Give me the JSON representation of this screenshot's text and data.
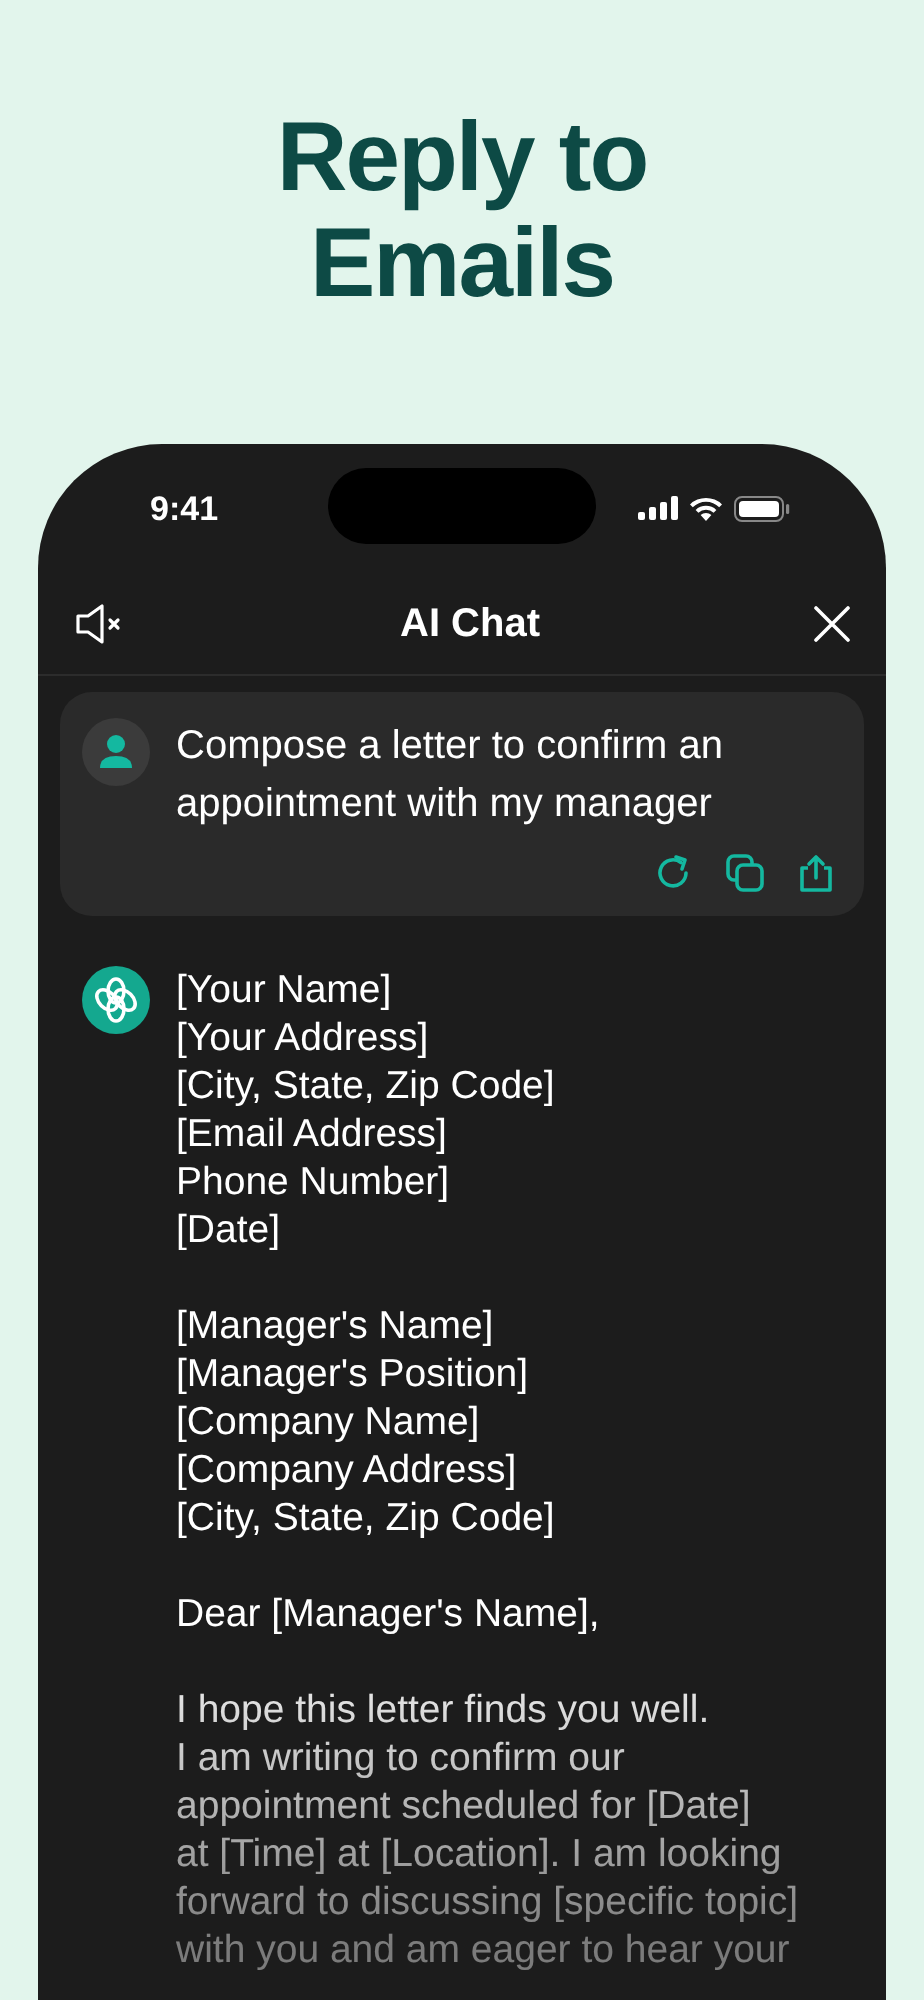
{
  "headline": [
    "Reply to",
    "Emails"
  ],
  "status_bar": {
    "time": "9:41"
  },
  "header": {
    "title": "AI Chat"
  },
  "prompt": {
    "text": "Compose a letter to confirm an appointment with my manager"
  },
  "reply": {
    "paragraphs": [
      [
        "[Your Name]",
        "[Your Address]",
        "[City, State, Zip Code]",
        "[Email Address]",
        "Phone Number]",
        "[Date]"
      ],
      [
        "[Manager's Name]",
        "[Manager's Position]",
        "[Company Name]",
        "[Company Address]",
        "[City, State, Zip Code]"
      ],
      [
        "Dear [Manager's Name],"
      ],
      [
        "I hope this letter finds you well.",
        "I am writing to confirm our",
        "appointment scheduled for [Date]",
        "at [Time] at [Location]. I am looking",
        "forward to discussing [specific topic]",
        "with you and am eager to hear your"
      ]
    ]
  }
}
